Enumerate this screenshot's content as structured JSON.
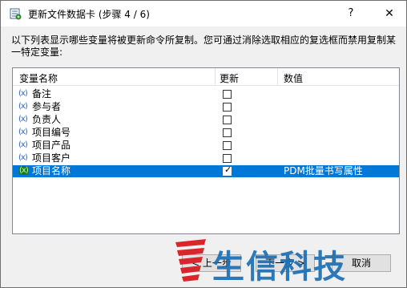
{
  "window": {
    "title": "更新文件数据卡 (步骤 4 / 6)",
    "help_label": "?",
    "close_label": "✕"
  },
  "description": "以下列表显示哪些变量将被更新命令所复制。您可通过消除选取相应的复选框而禁用复制某一特定变量:",
  "table": {
    "headers": [
      "变量名称",
      "更新",
      "数值"
    ],
    "rows": [
      {
        "icon": "(x)",
        "name": "备注",
        "checked": false,
        "value": ""
      },
      {
        "icon": "(x)",
        "name": "参与者",
        "checked": false,
        "value": ""
      },
      {
        "icon": "(x)",
        "name": "负责人",
        "checked": false,
        "value": ""
      },
      {
        "icon": "(x)",
        "name": "项目编号",
        "checked": false,
        "value": ""
      },
      {
        "icon": "(x)",
        "name": "项目产品",
        "checked": false,
        "value": ""
      },
      {
        "icon": "(x)",
        "name": "项目客户",
        "checked": false,
        "value": ""
      },
      {
        "icon": "(x)",
        "name": "项目名称",
        "checked": true,
        "value": "PDM批量书写属性",
        "selected": true
      }
    ]
  },
  "buttons": {
    "back": "< 上一步",
    "next": "下一步 >",
    "cancel": "取消"
  },
  "watermark": {
    "text": "生信科技"
  },
  "colors": {
    "selection": "#0078d7",
    "watermark_blue": "#1b6fb5",
    "watermark_red": "#d8262c"
  }
}
